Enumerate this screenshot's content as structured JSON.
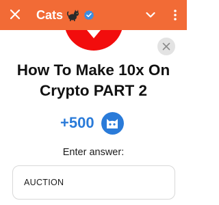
{
  "colors": {
    "accent": "#f26b36",
    "blue": "#2a7bd9",
    "youtube_red": "#f20d0d"
  },
  "header": {
    "title": "Cats",
    "icons": [
      "close-icon",
      "cat-emoji-icon",
      "verified-badge-icon",
      "chevron-down-icon",
      "more-vert-icon"
    ]
  },
  "content": {
    "video_title": "How To Make 10x On Crypto PART 2",
    "reward_amount": "+500",
    "prompt": "Enter answer:",
    "answer_value": "AUCTION"
  }
}
